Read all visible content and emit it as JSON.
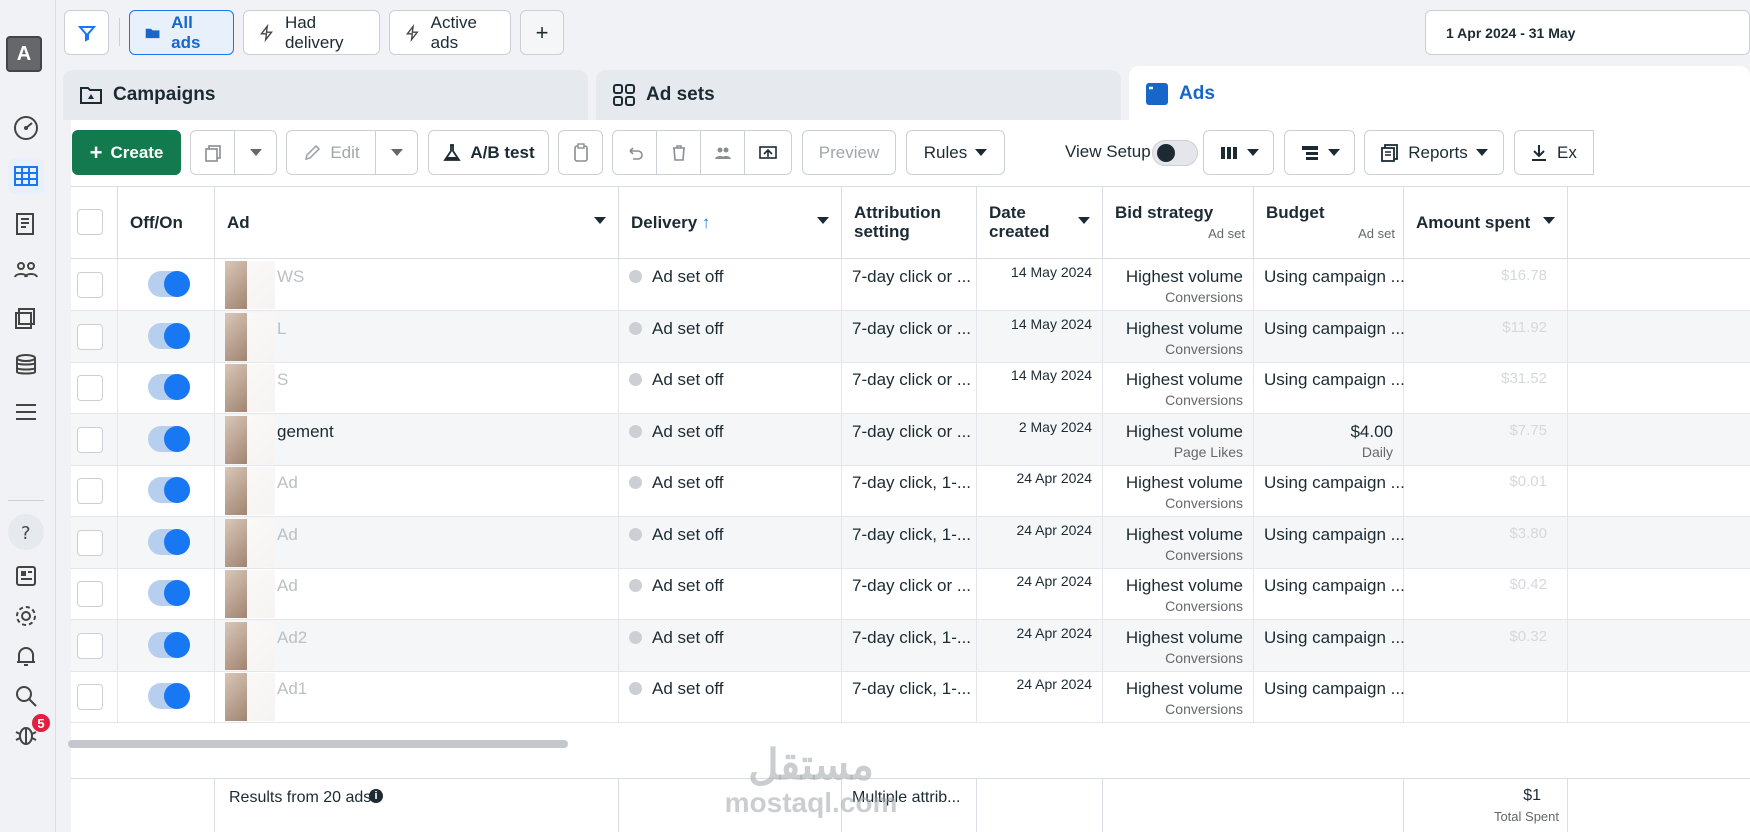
{
  "account": {
    "avatar_letter": "A"
  },
  "notifications": {
    "count": "5"
  },
  "filters": {
    "all_ads": "All ads",
    "had_delivery": "Had delivery",
    "active_ads": "Active ads",
    "add": "+"
  },
  "date_range": "1 Apr 2024 - 31 May",
  "levels": {
    "campaigns": "Campaigns",
    "ad_sets": "Ad sets",
    "ads": "Ads"
  },
  "toolbar": {
    "create": "Create",
    "edit": "Edit",
    "ab_test": "A/B test",
    "preview": "Preview",
    "rules": "Rules",
    "view_setup": "View Setup",
    "reports": "Reports",
    "export": "Ex"
  },
  "columns": {
    "off_on": "Off/On",
    "ad": "Ad",
    "delivery": "Delivery",
    "delivery_sort": "↑",
    "attribution": "Attribution setting",
    "date_created": "Date created",
    "bid_strategy": "Bid strategy",
    "bid_strategy_sub": "Ad set",
    "budget": "Budget",
    "budget_sub": "Ad set",
    "amount_spent": "Amount spent"
  },
  "rows": [
    {
      "ad": "WS",
      "delivery": "Ad set off",
      "attribution": "7-day click or ...",
      "date": "14 May 2024",
      "bid": "Highest volume",
      "bid_sub": "Conversions",
      "budget": "Using campaign ...",
      "budget_sub": "",
      "spent": "$16.78"
    },
    {
      "ad": "L",
      "delivery": "Ad set off",
      "attribution": "7-day click or ...",
      "date": "14 May 2024",
      "bid": "Highest volume",
      "bid_sub": "Conversions",
      "budget": "Using campaign ...",
      "budget_sub": "",
      "spent": "$11.92"
    },
    {
      "ad": "S",
      "delivery": "Ad set off",
      "attribution": "7-day click or ...",
      "date": "14 May 2024",
      "bid": "Highest volume",
      "bid_sub": "Conversions",
      "budget": "Using campaign ...",
      "budget_sub": "",
      "spent": "$31.52"
    },
    {
      "ad": "gement",
      "delivery": "Ad set off",
      "attribution": "7-day click or ...",
      "date": "2 May 2024",
      "bid": "Highest volume",
      "bid_sub": "Page Likes",
      "budget": "$4.00",
      "budget_sub": "Daily",
      "spent": "$7.75"
    },
    {
      "ad": "Ad",
      "delivery": "Ad set off",
      "attribution": "7-day click, 1-...",
      "date": "24 Apr 2024",
      "bid": "Highest volume",
      "bid_sub": "Conversions",
      "budget": "Using campaign ...",
      "budget_sub": "",
      "spent": "$0.01"
    },
    {
      "ad": "Ad",
      "delivery": "Ad set off",
      "attribution": "7-day click, 1-...",
      "date": "24 Apr 2024",
      "bid": "Highest volume",
      "bid_sub": "Conversions",
      "budget": "Using campaign ...",
      "budget_sub": "",
      "spent": "$3.80"
    },
    {
      "ad": "Ad",
      "delivery": "Ad set off",
      "attribution": "7-day click or ...",
      "date": "24 Apr 2024",
      "bid": "Highest volume",
      "bid_sub": "Conversions",
      "budget": "Using campaign ...",
      "budget_sub": "",
      "spent": "$0.42"
    },
    {
      "ad": "Ad2",
      "delivery": "Ad set off",
      "attribution": "7-day click, 1-...",
      "date": "24 Apr 2024",
      "bid": "Highest volume",
      "bid_sub": "Conversions",
      "budget": "Using campaign ...",
      "budget_sub": "",
      "spent": "$0.32"
    },
    {
      "ad": "Ad1",
      "delivery": "Ad set off",
      "attribution": "7-day click, 1-...",
      "date": "24 Apr 2024",
      "bid": "Highest volume",
      "bid_sub": "Conversions",
      "budget": "Using campaign ...",
      "budget_sub": "",
      "spent": ""
    }
  ],
  "footer": {
    "results": "Results from 20 ads",
    "attribution": "Multiple attrib...",
    "spent": "$1",
    "spent_label": "Total Spent"
  },
  "watermark": {
    "ar": "مستقل",
    "en": "mostaql.com"
  },
  "colors": {
    "primary": "#1877f2",
    "create": "#137a4f",
    "badge": "#e41e3f"
  }
}
